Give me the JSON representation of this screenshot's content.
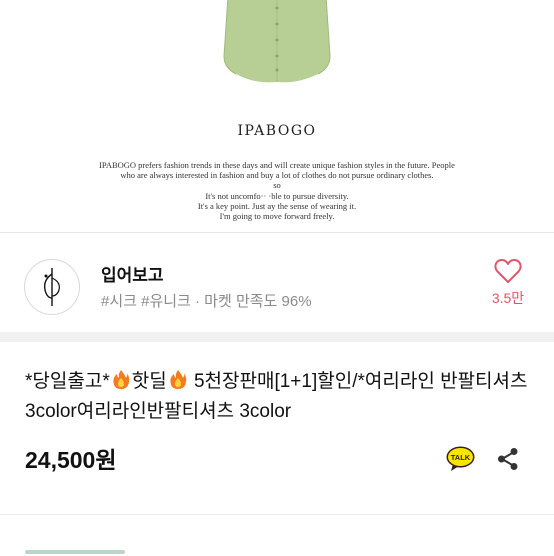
{
  "hero": {
    "brand": "IPABOGO",
    "tagline_lines": [
      "IPABOGO prefers fashion trends in these days and will create unique fashion styles in the future. People",
      "who are always interested in fashion and buy a lot of clothes do not pursue ordinary clothes.",
      "so",
      "It's not uncomfo·· ·ble to pursue diversity.",
      "It's a key point. Just ay the sense of wearing it.",
      "I'm going to move forward freely."
    ],
    "shirt_color": "#b7cf94"
  },
  "shop": {
    "name": "입어보고",
    "tags": "#시크 #유니크 · 마켓 만족도 96%",
    "like_count": "3.5만",
    "like_color": "#e0566b"
  },
  "product": {
    "title_part1": "*당일출고*",
    "title_part2": "핫딜",
    "title_part3": "5천장판매[1+1]할인/*여리라인 반팔티셔츠 3color여리라인반팔티셔츠 3color",
    "price": "24,500원",
    "talk_label": "TALK"
  },
  "icons": {
    "heart": "heart-outline-icon",
    "flame": "fire-emoji-icon",
    "talk": "kakaotalk-icon",
    "share": "share-icon"
  }
}
